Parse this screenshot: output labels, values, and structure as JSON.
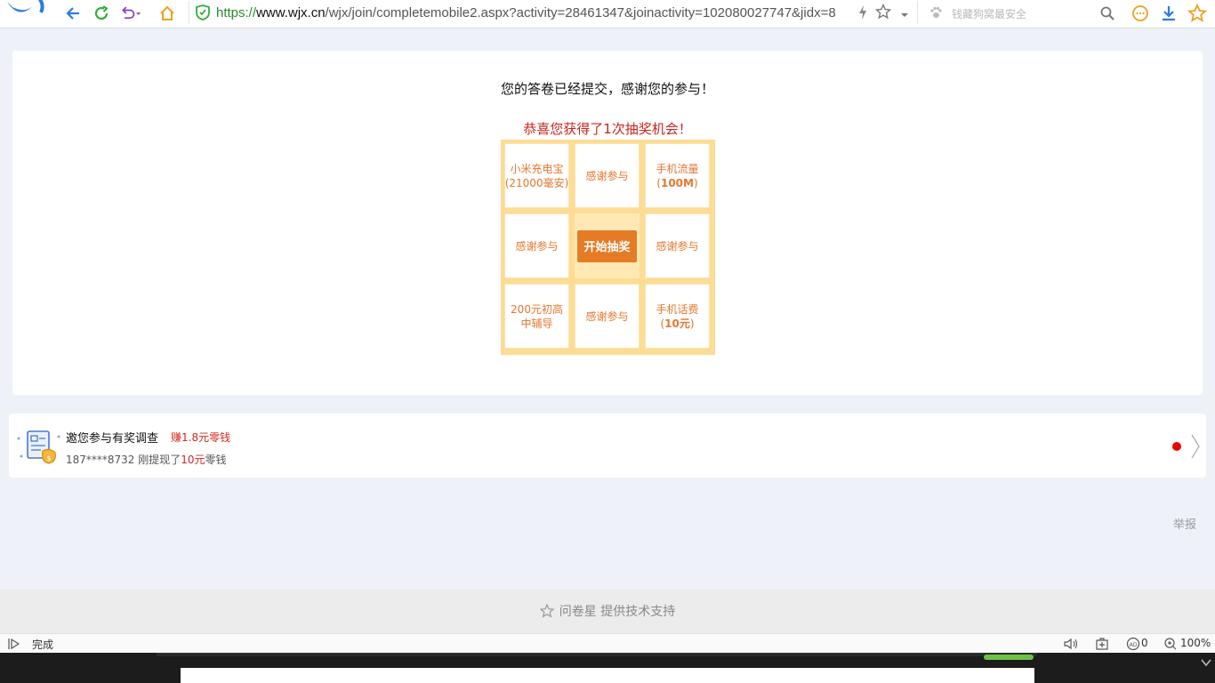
{
  "browser": {
    "url_prefix": "https://",
    "url_host": "www.wjx.cn",
    "url_rest": "/wjx/join/completemobile2.aspx?activity=28461347&joinactivity=102080027747&jidx=8",
    "search_placeholder": "钱藏狗窝最安全"
  },
  "result": {
    "done_message": "您的答卷已经提交，感谢您的参与！",
    "prize_message": "恭喜您获得了1次抽奖机会！"
  },
  "lottery": {
    "cells": [
      {
        "line1": "小米充电宝",
        "line2": "(21000毫安)",
        "bold": ""
      },
      {
        "line1": "感谢参与",
        "line2": "",
        "bold": ""
      },
      {
        "line1": "手机流量",
        "line2": "(",
        "bold": "100M",
        "after": ")"
      },
      {
        "line1": "感谢参与",
        "line2": "",
        "bold": ""
      },
      {
        "line1": "感谢参与",
        "line2": "",
        "bold": ""
      },
      {
        "line1": "200元初高",
        "line2": "中辅导",
        "bold": ""
      },
      {
        "line1": "感谢参与",
        "line2": "",
        "bold": ""
      },
      {
        "line1": "手机话费",
        "line2": "(",
        "bold": "10元",
        "after": ")"
      }
    ],
    "start_label": "开始抽奖"
  },
  "invite": {
    "title": "邀您参与有奖调查",
    "earn": "赚1.8元零钱",
    "sub_prefix": "187****8732 刚提现了",
    "sub_amount": "10元",
    "sub_suffix": "零钱"
  },
  "report_label": "举报",
  "footer_text": "问卷星 提供技术支持",
  "status": {
    "text": "完成",
    "ad_count": "0",
    "zoom": "100%"
  },
  "colors": {
    "accent_orange": "#e57b25",
    "prize_red": "#c8251e",
    "grid_border": "#fddc94"
  }
}
